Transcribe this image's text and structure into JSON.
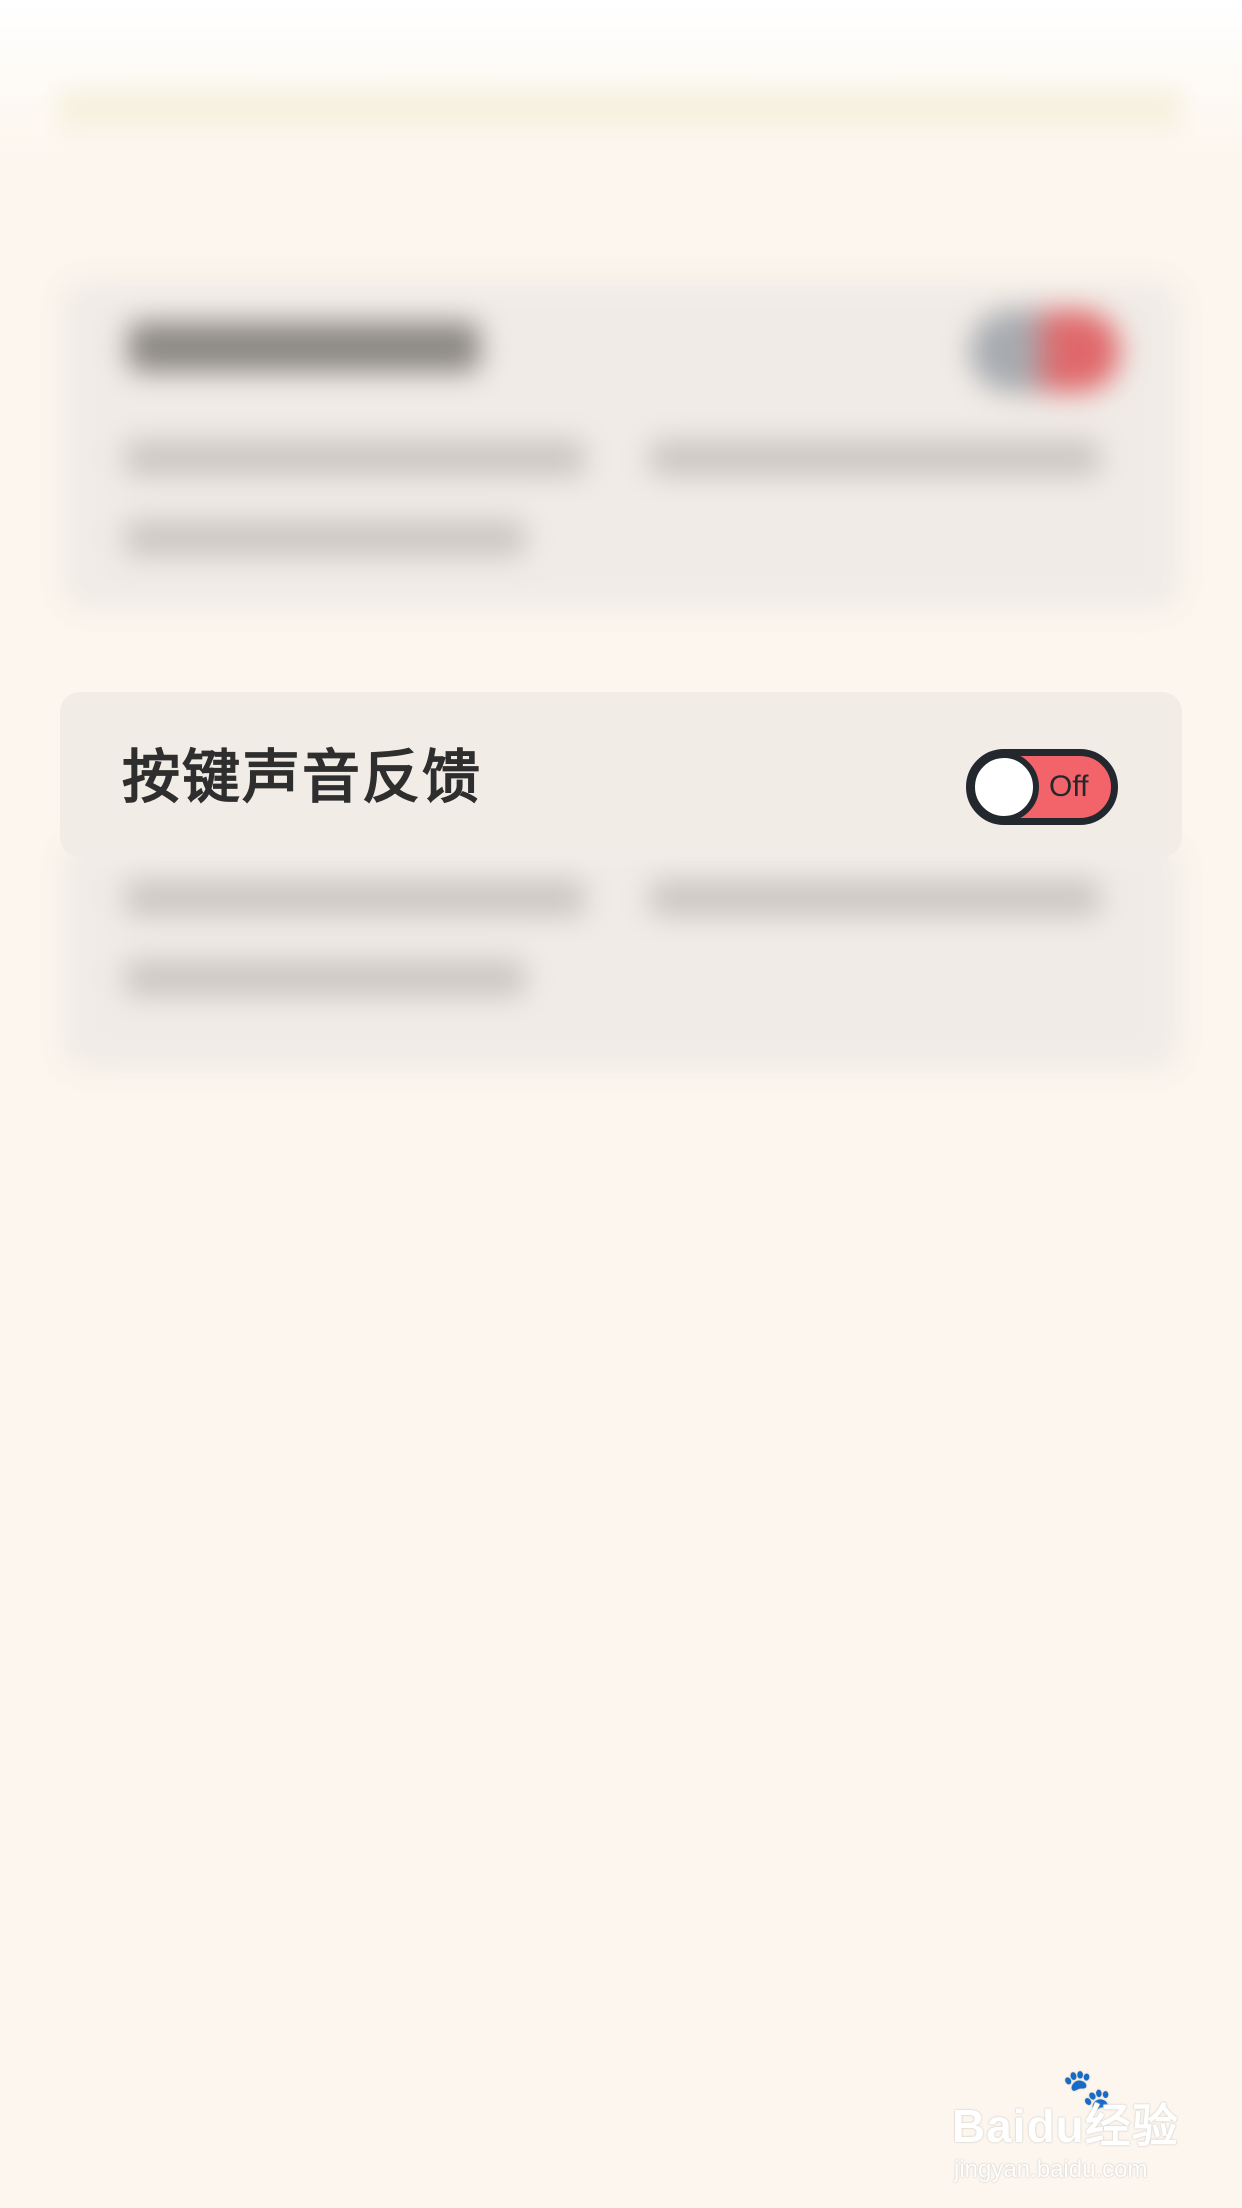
{
  "setting": {
    "label": "按键声音反馈",
    "toggle_state": "Off",
    "toggle_on": false,
    "toggle_color": "#f2646a",
    "toggle_border_color": "#23282e"
  },
  "background_color": "#fcf6ee",
  "watermark": {
    "logo": "Baidu经验",
    "url": "jingyan.baidu.com"
  }
}
